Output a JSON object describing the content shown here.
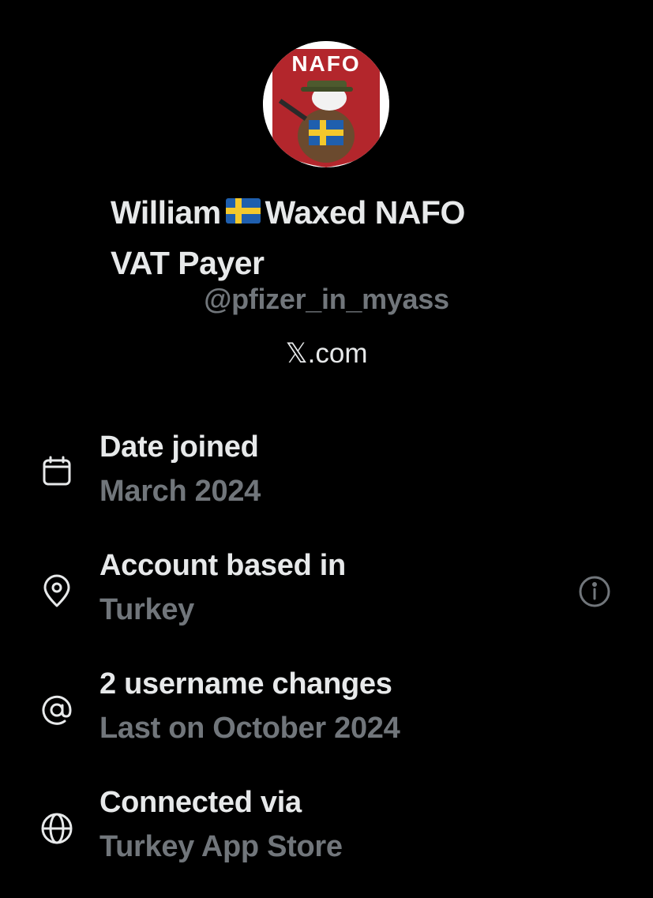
{
  "profile": {
    "avatar_text": "NAFO",
    "name_part1": "William",
    "flag": "sweden-flag",
    "name_part2": "Waxed NAFO",
    "name_line2": "VAT Payer",
    "handle": "@pfizer_in_myass",
    "site": "𝕏.com"
  },
  "details": [
    {
      "icon": "calendar-icon",
      "title": "Date joined",
      "value": "March 2024"
    },
    {
      "icon": "location-pin-icon",
      "title": "Account based in",
      "value": "Turkey"
    },
    {
      "icon": "at-sign-icon",
      "title": "2 username changes",
      "value": "Last on October 2024"
    },
    {
      "icon": "globe-icon",
      "title": "Connected via",
      "value": "Turkey App Store"
    }
  ],
  "colors": {
    "background": "#000000",
    "primary_text": "#e7e9ea",
    "secondary_text": "#71767b",
    "avatar_badge_red": "#b3262c",
    "flag_blue": "#1f5fae",
    "flag_yellow": "#f4c82c"
  }
}
